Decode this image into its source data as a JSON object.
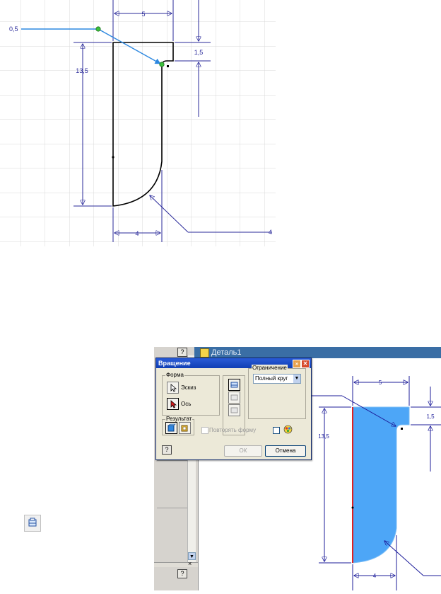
{
  "top_sketch": {
    "dims": {
      "top_width": "5",
      "notch_height": "1,5",
      "left_height": "13,5",
      "bottom_width": "4",
      "leader_left": "0,5",
      "leader_right": "4"
    }
  },
  "bottom_window": {
    "document_tab": "Деталь1",
    "help_label": "?",
    "close_label": "×",
    "dims": {
      "top_width": "5",
      "notch_height": "1,5",
      "left_height": "13,5",
      "bottom_width": "4"
    },
    "colors": {
      "profile_fill": "#4da6f7",
      "axis_line": "#e02020",
      "sketch_dim": "#1c1c9a"
    }
  },
  "dialog": {
    "title": "Вращение",
    "form_group_label": "Форма",
    "sketch_label": "Эскиз",
    "axis_label": "Ось",
    "result_group_label": "Результат",
    "limit_group_label": "Ограничение",
    "limit_value": "Полный круг",
    "repeat_form_label": "Повторять форму",
    "ok_label": "ОК",
    "cancel_label": "Отмена",
    "help_label": "?",
    "selected_result": "join"
  }
}
